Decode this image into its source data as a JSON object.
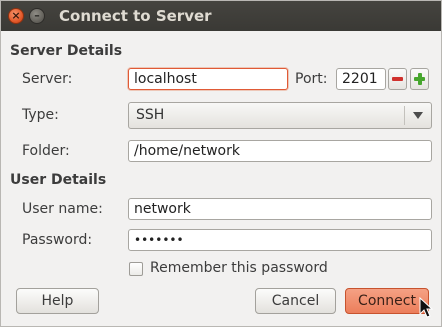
{
  "window": {
    "title": "Connect to Server"
  },
  "server_details": {
    "heading": "Server Details",
    "server_label": "Server:",
    "server_value": "localhost",
    "port_label": "Port:",
    "port_value": "2201",
    "type_label": "Type:",
    "type_value": "SSH",
    "folder_label": "Folder:",
    "folder_value": "/home/network"
  },
  "user_details": {
    "heading": "User Details",
    "username_label": "User name:",
    "username_value": "network",
    "password_label": "Password:",
    "password_value": "•••••••",
    "remember_label": "Remember this password",
    "remember_checked": false
  },
  "buttons": {
    "help": "Help",
    "cancel": "Cancel",
    "connect": "Connect"
  },
  "icons": {
    "close": "close-icon",
    "minimize": "minimize-icon",
    "port_decrease": "minus-icon",
    "port_increase": "plus-icon",
    "dropdown": "chevron-down-icon",
    "pointer": "mouse-pointer-icon"
  },
  "colors": {
    "accent": "#ec7e5b",
    "titlebar": "#3c3b37",
    "focus_border": "#e05a36"
  }
}
